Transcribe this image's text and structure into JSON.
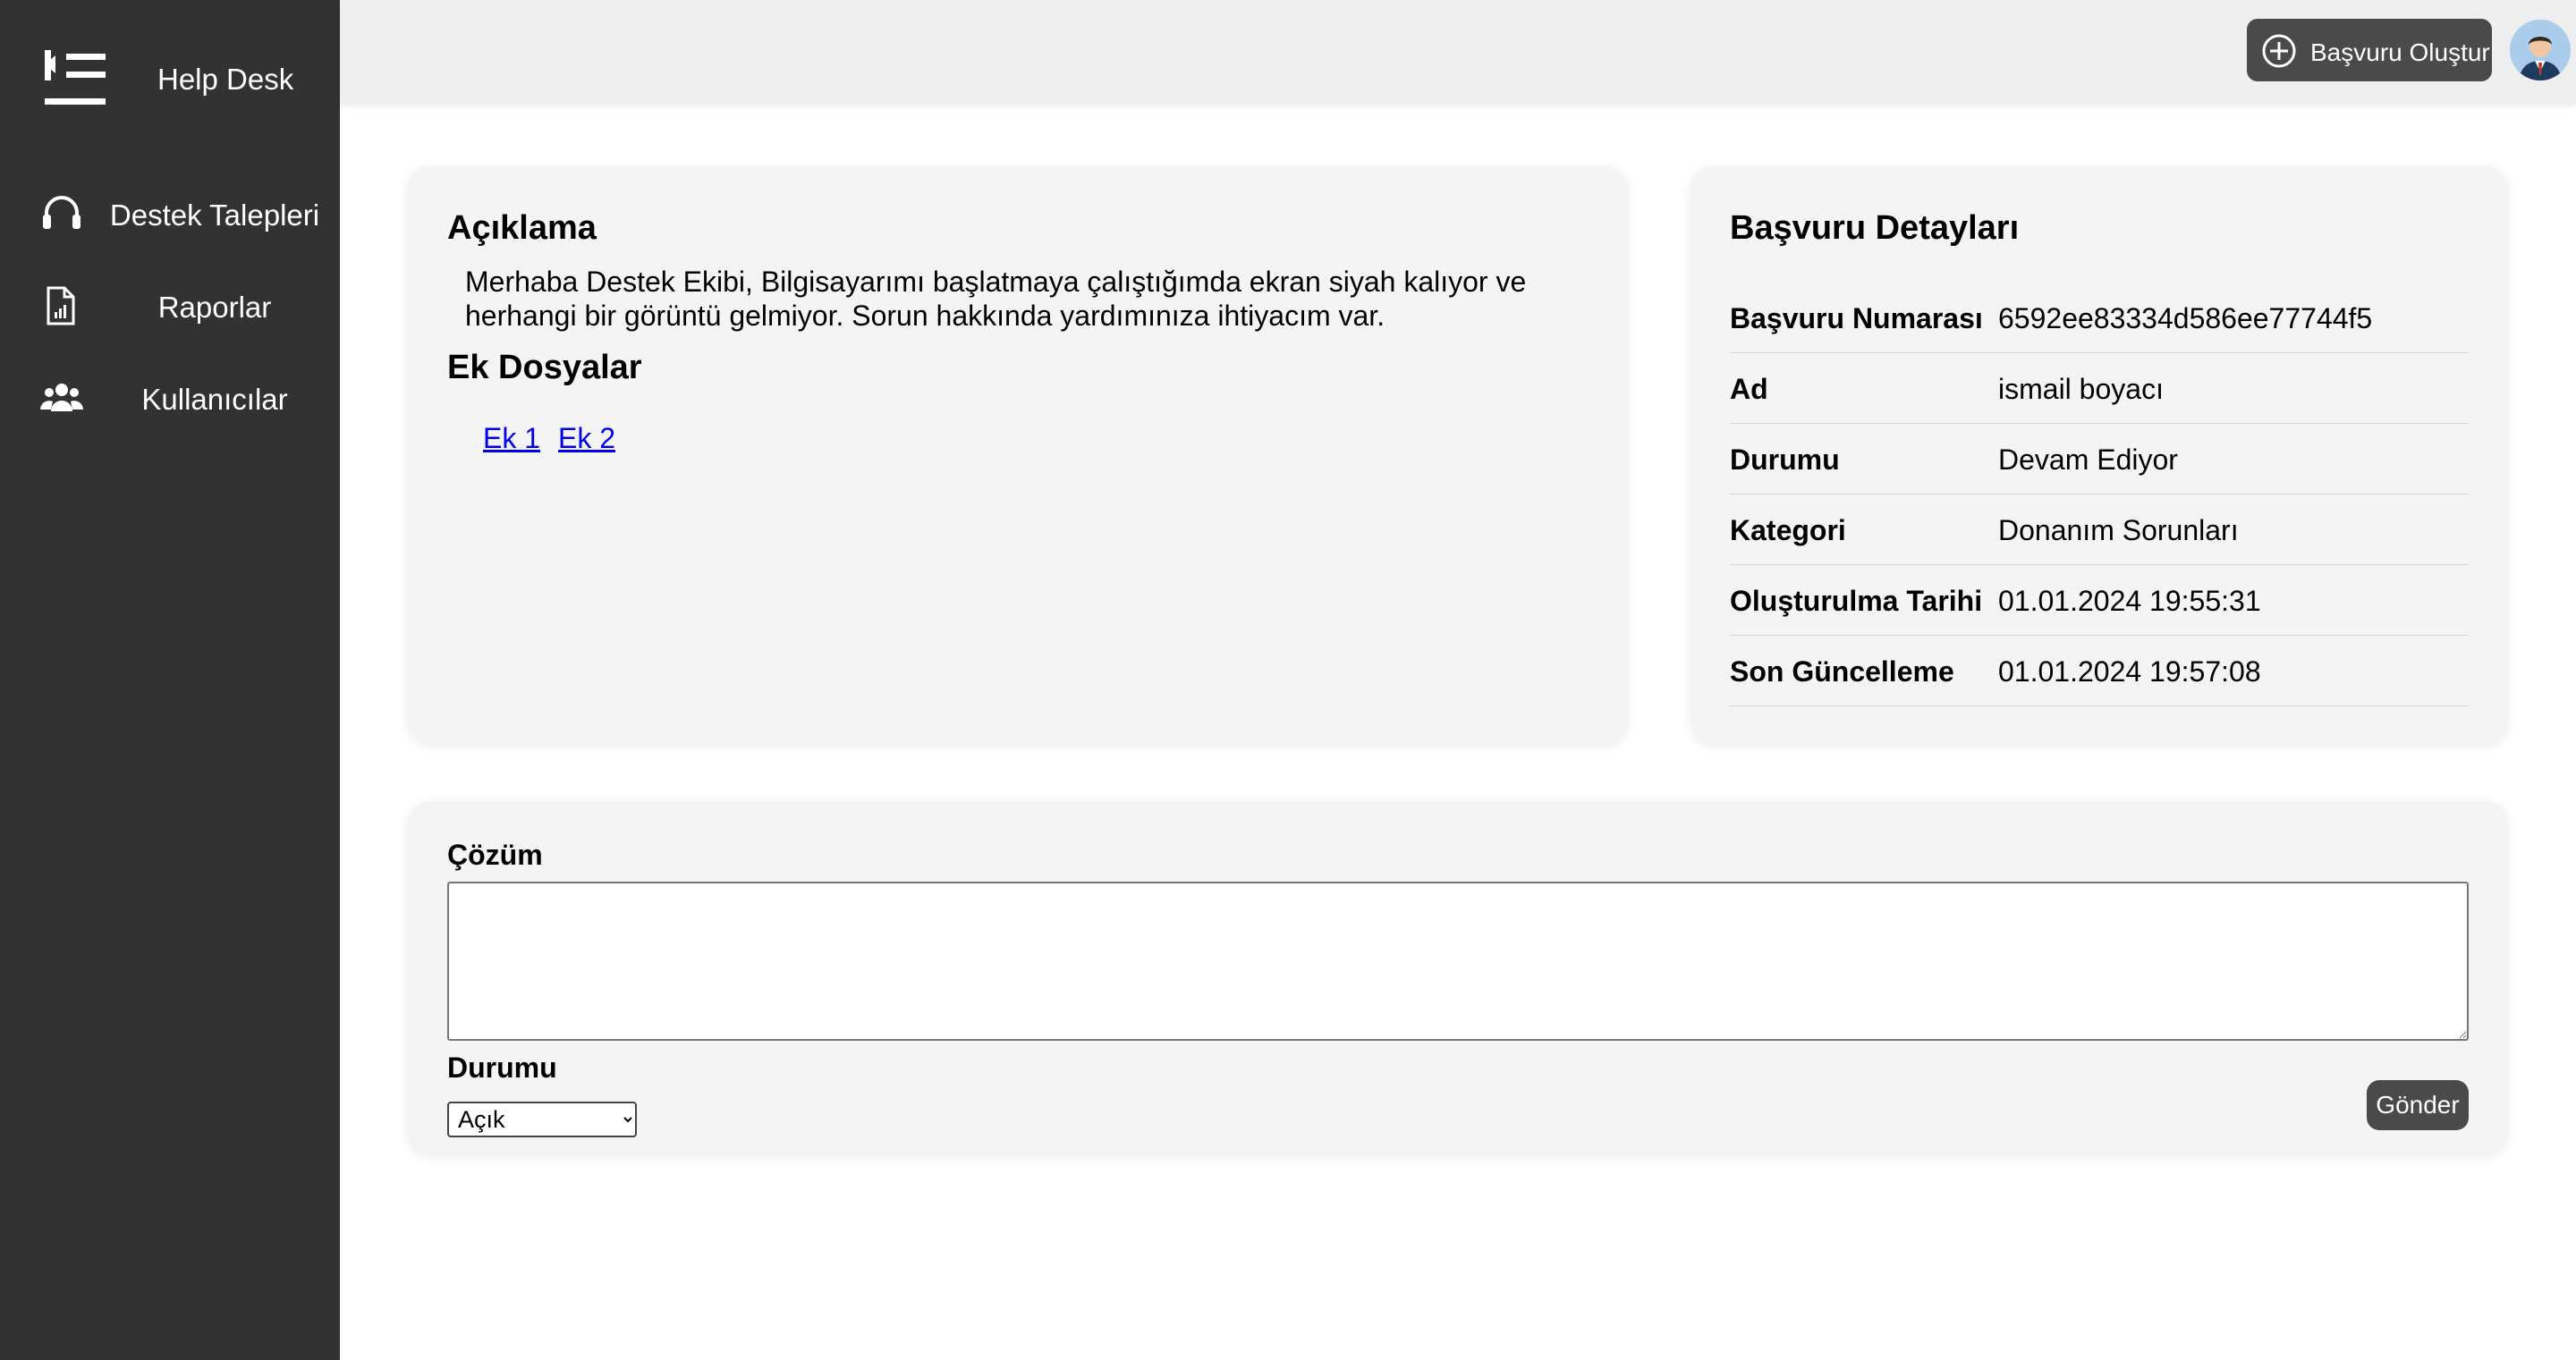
{
  "app": {
    "title": "Help Desk"
  },
  "sidebar": {
    "items": [
      {
        "label": "Destek Talepleri",
        "icon": "headset-icon"
      },
      {
        "label": "Raporlar",
        "icon": "report-icon"
      },
      {
        "label": "Kullanıcılar",
        "icon": "users-icon"
      }
    ]
  },
  "header": {
    "create_label": "Başvuru Oluştur"
  },
  "description": {
    "title": "Açıklama",
    "text": "Merhaba Destek Ekibi, Bilgisayarımı başlatmaya çalıştığımda ekran siyah kalıyor ve herhangi bir görüntü gelmiyor. Sorun hakkında yardımınıza ihtiyacım var.",
    "attachments_title": "Ek Dosyalar",
    "attachments": [
      "Ek 1",
      "Ek 2"
    ]
  },
  "details": {
    "title": "Başvuru Detayları",
    "rows": [
      {
        "key": "Başvuru Numarası",
        "value": "6592ee83334d586ee77744f5"
      },
      {
        "key": "Ad",
        "value": "ismail boyacı"
      },
      {
        "key": "Durumu",
        "value": "Devam Ediyor"
      },
      {
        "key": "Kategori",
        "value": "Donanım Sorunları"
      },
      {
        "key": "Oluşturulma Tarihi",
        "value": "01.01.2024 19:55:31"
      },
      {
        "key": "Son Güncelleme",
        "value": "01.01.2024 19:57:08"
      }
    ]
  },
  "solution": {
    "label": "Çözüm",
    "value": "",
    "status_label": "Durumu",
    "status_selected": "Açık",
    "submit_label": "Gönder"
  },
  "colors": {
    "sidebar_bg": "#323232",
    "topbar_bg": "#efefef",
    "button_bg": "#4a4a4a",
    "card_bg": "#f4f4f4",
    "link": "#0000ee"
  }
}
